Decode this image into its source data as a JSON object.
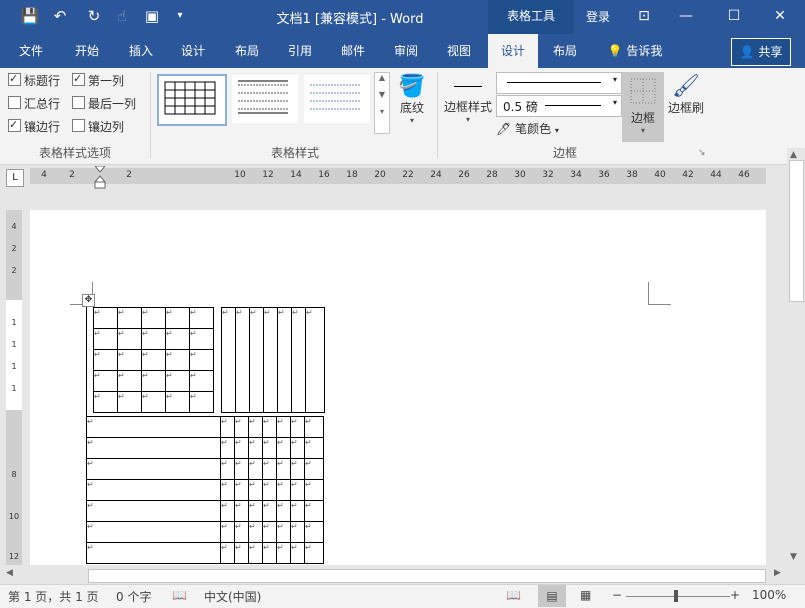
{
  "titlebar": {
    "doc_title": "文档1 [兼容模式] - Word",
    "context_tab": "表格工具",
    "login": "登录",
    "icons": [
      "save-icon",
      "undo-icon",
      "redo-icon",
      "touch-mode-icon",
      "print-preview-icon",
      "customize-qat-icon"
    ]
  },
  "tabs": [
    {
      "label": "文件",
      "active": false
    },
    {
      "label": "开始",
      "active": false
    },
    {
      "label": "插入",
      "active": false
    },
    {
      "label": "设计",
      "active": false
    },
    {
      "label": "布局",
      "active": false
    },
    {
      "label": "引用",
      "active": false
    },
    {
      "label": "邮件",
      "active": false
    },
    {
      "label": "审阅",
      "active": false
    },
    {
      "label": "视图",
      "active": false
    },
    {
      "label": "设计",
      "active": true
    },
    {
      "label": "布局",
      "active": false
    }
  ],
  "tell_me": "告诉我",
  "share": "共享",
  "ribbon": {
    "style_options": {
      "checkboxes": [
        {
          "label": "标题行",
          "checked": true
        },
        {
          "label": "第一列",
          "checked": true
        },
        {
          "label": "汇总行",
          "checked": false
        },
        {
          "label": "最后一列",
          "checked": false
        },
        {
          "label": "镶边行",
          "checked": true
        },
        {
          "label": "镶边列",
          "checked": false
        }
      ],
      "group_label": "表格样式选项"
    },
    "table_styles": {
      "group_label": "表格样式"
    },
    "shading": "底纹",
    "border_styles": "边框样式",
    "pen_weight": "0.5 磅",
    "pen_color": "笔颜色",
    "borders_btn": "边框",
    "border_painter": "边框刷",
    "borders_group_label": "边框"
  },
  "ruler": {
    "tab_selector": "L",
    "h_numbers": [
      "4",
      "2",
      "2",
      "10",
      "12",
      "14",
      "16",
      "18",
      "20",
      "22",
      "24",
      "26",
      "28",
      "30",
      "32",
      "34",
      "36",
      "38",
      "40",
      "42",
      "44",
      "46"
    ],
    "v_numbers": [
      "4",
      "2",
      "2",
      "1",
      "1",
      "1",
      "1",
      "8",
      "10",
      "12"
    ]
  },
  "table": {
    "cell_mark": "↵"
  },
  "status": {
    "page": "第 1 页，共 1 页",
    "words": "0 个字",
    "lang": "中文(中国)",
    "zoom": "100%"
  }
}
